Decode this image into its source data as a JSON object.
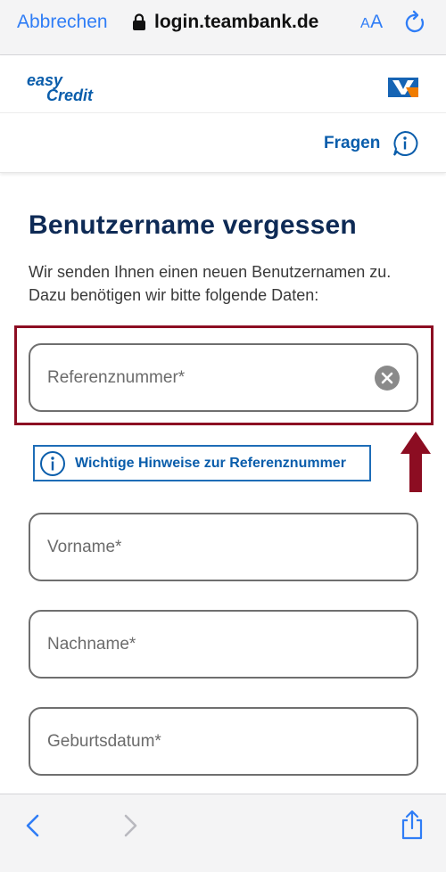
{
  "browser": {
    "cancel_label": "Abbrechen",
    "url": "login.teambank.de",
    "text_size_label_small": "A",
    "text_size_label_large": "A",
    "icons": {
      "lock": "lock-icon",
      "reload": "reload-icon",
      "back": "chevron-left-icon",
      "forward": "chevron-right-icon",
      "share": "share-icon"
    }
  },
  "header": {
    "logo": {
      "line1": "easy",
      "line2": "Credit"
    },
    "help_label": "Fragen"
  },
  "main": {
    "title": "Benutzername vergessen",
    "subtitle": "Wir senden Ihnen einen neuen Benutzernamen zu. Dazu benötigen wir bitte folgende Daten:",
    "fields": {
      "reference": {
        "placeholder": "Referenznummer*"
      },
      "firstname": {
        "placeholder": "Vorname*"
      },
      "lastname": {
        "placeholder": "Nachname*"
      },
      "birthdate": {
        "placeholder": "Geburtsdatum*"
      }
    },
    "hint_label": "Wichtige Hinweise zur Referenznummer"
  },
  "colors": {
    "brand_blue": "#0a5dab",
    "title_navy": "#0e2a55",
    "safari_blue": "#2f7df6",
    "highlight_red": "#8c0d22",
    "vr_orange": "#f07c00"
  }
}
